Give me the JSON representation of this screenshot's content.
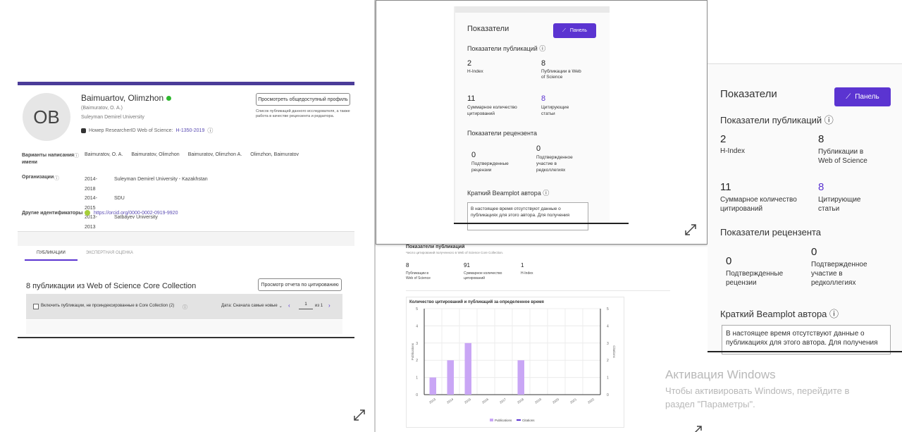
{
  "profile": {
    "avatar_initials": "OB",
    "name": "Baimuartov, Olimzhon",
    "alt_name": "(Baimuratov, O. A.)",
    "affiliation": "Suleyman Demirel University",
    "researcher_id_label": "Номер ResearcherID Web of Science:",
    "researcher_id_value": "H-1350-2019",
    "view_public_button": "Просмотреть общедоступный профиль",
    "note": "Список публикаций данного исследователя, а также работа в качестве рецензента и редактора.",
    "name_variants_label": "Варианты написания имени",
    "name_variants": [
      "Baimuratov, O. A.",
      "Baimuratov, Olimzhon",
      "Baimuratov, Olimzhon A.",
      "Olimzhon, Baimuratov"
    ],
    "orgs_label": "Организации",
    "orgs": [
      {
        "years": "2014-2018",
        "name": "Suleyman Demirel University - Kazakhstan"
      },
      {
        "years": "2014-2015",
        "name": "SDU"
      },
      {
        "years": "2013-2013",
        "name": "Satbayev University"
      }
    ],
    "other_ids_label": "Другие идентификаторы",
    "orcid": "https://orcid.org/0000-0002-0919-9920",
    "tabs": [
      "ПУБЛИКАЦИИ",
      "ЭКСПЕРТНАЯ ОЦЕНКА"
    ],
    "pubs_heading": "8 публикации из Web of Science Core Collection",
    "citation_report_button": "Просмотр отчета по цитированию",
    "include_checkbox": "Включить публикации, не проиндексированные в Core Collection (2)",
    "sort_label": "Дата: Сначала самые новые",
    "page_current": "1",
    "page_of": "из 1"
  },
  "metrics_small": {
    "title": "Показатели",
    "panel_button": "Панель",
    "pub_metrics_title": "Показатели публикаций",
    "h_index_value": "2",
    "h_index_label": "H-Index",
    "wos_pubs_value": "8",
    "wos_pubs_label": "Публикации в Web of Science",
    "citations_value": "11",
    "citations_label": "Суммарное количество цитирований",
    "citing_value": "8",
    "citing_label": "Цитирующие статьи",
    "reviewer_title": "Показатели рецензента",
    "verified_reviews_value": "0",
    "verified_reviews_label": "Подтвержденные рецензии",
    "editorial_value": "0",
    "editorial_label": "Подтвержденное участие в редколлегиях",
    "beamplot_title": "Краткий Beamplot автора",
    "beamplot_text": "В настоящее время отсутствуют данные о публикациях для этого автора. Для получения"
  },
  "metrics_large": {
    "title": "Показатели",
    "panel_button": "Панель",
    "pub_metrics_title": "Показатели публикаций",
    "h_index_value": "2",
    "h_index_label": "H-Index",
    "wos_pubs_value": "8",
    "wos_pubs_label": "Публикации в Web of Science",
    "citations_value": "11",
    "citations_label": "Суммарное количество цитирований",
    "citing_value": "8",
    "citing_label": "Цитирующие статьи",
    "reviewer_title": "Показатели рецензента",
    "verified_reviews_value": "0",
    "verified_reviews_label": "Подтвержденные рецензии",
    "editorial_value": "0",
    "editorial_label": "Подтвержденное участие в редколлегиях",
    "beamplot_title": "Краткий Beamplot автора",
    "beamplot_text": "В настоящее время отсутствуют данные о публикациях для этого автора. Для получения"
  },
  "chart_panel": {
    "title": "Показатели публикаций",
    "subtitle": "Число цитирований полученного в Web of Science Core Collection.",
    "stats": [
      {
        "value": "8",
        "label": "Публикации в Web of Science"
      },
      {
        "value": "91",
        "label": "Суммарное количество цитирований"
      },
      {
        "value": "1",
        "label": "H-Index"
      }
    ],
    "chart_title": "Количество цитирований и публикаций за определенное время"
  },
  "chart_data": {
    "type": "bar",
    "title": "Количество цитирований и публикаций за определенное время",
    "categories": [
      "2013",
      "2014",
      "2015",
      "2016",
      "2017",
      "2018",
      "2019",
      "2020",
      "2021",
      "2022"
    ],
    "series": [
      {
        "name": "Publications",
        "values": [
          1,
          2,
          3,
          0,
          0,
          2,
          0,
          0,
          0,
          0
        ]
      },
      {
        "name": "Citations",
        "values": [
          0,
          0,
          0,
          0,
          0,
          0,
          0,
          0,
          0,
          0
        ]
      }
    ],
    "ylabel": "Publications",
    "y2label": "Citations",
    "ylim": [
      0,
      5
    ],
    "yticks": [
      "0",
      "1",
      "2",
      "3",
      "4",
      "5"
    ],
    "legend": "bottom",
    "colors": {
      "Publications": "#c9a6f5",
      "Citations": "#5b34d1"
    }
  },
  "windows": {
    "activation_title": "Активация Windows",
    "activation_line1": "Чтобы активировать Windows, перейдите в",
    "activation_line2": "раздел \"Параметры\"."
  },
  "colors": {
    "accent": "#5b34d1",
    "header_bar": "#4b3c99",
    "windows_blue": "#0078d4"
  }
}
